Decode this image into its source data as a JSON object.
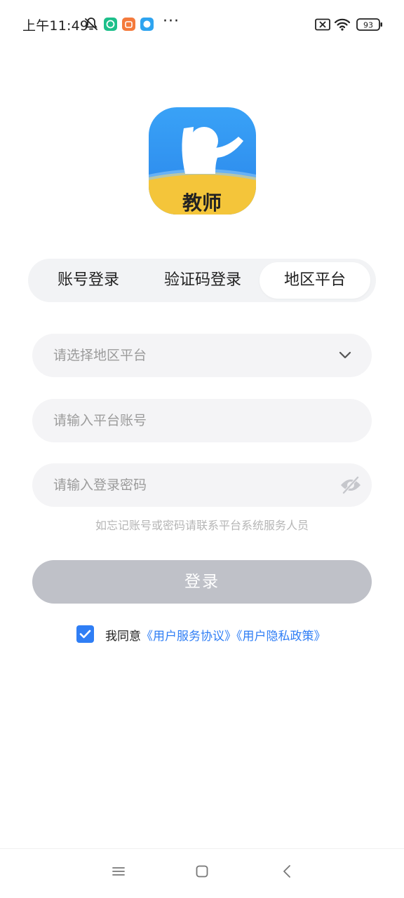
{
  "status_bar": {
    "time": "上午11:49",
    "more": "···",
    "battery": "93",
    "icons": [
      "mute-bell-icon",
      "green-app-icon",
      "orange-app-icon",
      "blue-app-icon",
      "sim-off-icon",
      "wifi-icon",
      "battery-icon"
    ]
  },
  "logo": {
    "text": "教师",
    "colors": {
      "blue": "#2e8ff0",
      "yellow": "#f4c53a"
    }
  },
  "tabs": [
    {
      "label": "账号登录",
      "active": false
    },
    {
      "label": "验证码登录",
      "active": false
    },
    {
      "label": "地区平台",
      "active": true
    }
  ],
  "form": {
    "region_placeholder": "请选择地区平台",
    "account_placeholder": "请输入平台账号",
    "password_placeholder": "请输入登录密码",
    "hint": "如忘记账号或密码请联系平台系统服务人员",
    "login_label": "登录"
  },
  "agreement": {
    "checked": true,
    "prefix": "我同意",
    "service_link": "《用户服务协议》",
    "privacy_link": "《用户隐私政策》"
  },
  "colors": {
    "accent": "#2f7ef5",
    "button_disabled": "#bfc1c8",
    "field_bg": "#f4f4f6"
  }
}
